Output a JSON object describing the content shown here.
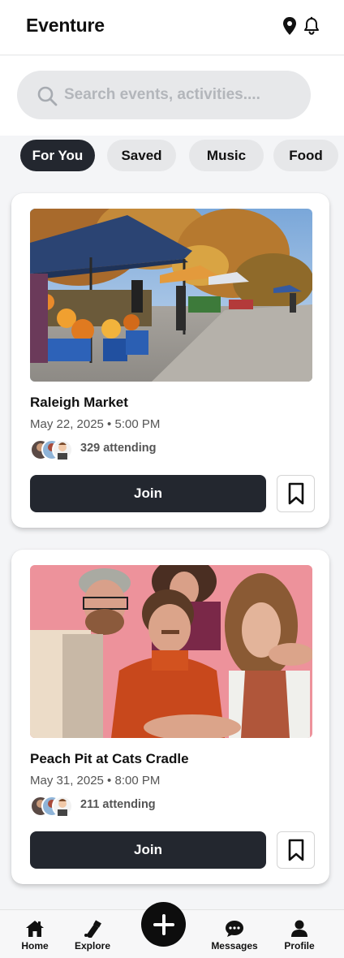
{
  "app": {
    "title": "Eventure"
  },
  "header": {
    "location_icon": "map-pin-icon",
    "notifications_icon": "bell-icon"
  },
  "search": {
    "placeholder": "Search events, activities....",
    "icon": "search-icon"
  },
  "filters": [
    {
      "label": "For You",
      "active": true
    },
    {
      "label": "Saved",
      "active": false
    },
    {
      "label": "Music",
      "active": false
    },
    {
      "label": "Food",
      "active": false
    }
  ],
  "events": [
    {
      "title": "Raleigh Market",
      "date": "May 22, 2025 • 5:00 PM",
      "attending": "329 attending",
      "join_label": "Join",
      "bookmark_icon": "bookmark-icon",
      "image": "photo of outdoor farmers market with canopy tents, flowers and autumn trees"
    },
    {
      "title": "Peach Pit at Cats Cradle",
      "date": "May 31, 2025 • 8:00 PM",
      "attending": "211 attending",
      "join_label": "Join",
      "bookmark_icon": "bookmark-icon",
      "image": "band photo of four young men against a pink background"
    }
  ],
  "bottom_nav": [
    {
      "label": "Home",
      "icon": "home-icon"
    },
    {
      "label": "Explore",
      "icon": "explore-icon"
    },
    {
      "label": "Messages",
      "icon": "messages-icon"
    },
    {
      "label": "Profile",
      "icon": "profile-icon"
    }
  ],
  "fab": {
    "icon": "plus-icon"
  },
  "colors": {
    "primary_dark": "#23272f",
    "chip_inactive": "#e6e7e9",
    "search_bg": "#e7e8ea",
    "page_bg": "#f4f5f7"
  }
}
